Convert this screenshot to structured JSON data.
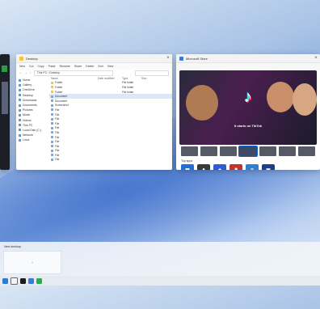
{
  "left_window": {
    "title": ""
  },
  "explorer": {
    "title": "Desktop",
    "toolbar": [
      "New",
      "Cut",
      "Copy",
      "Paste",
      "Rename",
      "Share",
      "Delete",
      "Sort",
      "View"
    ],
    "address": "This PC › Desktop",
    "sidebar": [
      "Home",
      "Gallery",
      "OneDrive",
      "Desktop",
      "Downloads",
      "Documents",
      "Pictures",
      "Music",
      "Videos",
      "This PC",
      "Local Disk (C:)",
      "Network",
      "Linux"
    ],
    "columns": [
      "Name",
      "Date modified",
      "Type",
      "Size"
    ],
    "rows": [
      {
        "name": "Folder",
        "date": "",
        "type": "File folder",
        "size": "",
        "kind": "folder"
      },
      {
        "name": "Folder",
        "date": "",
        "type": "File folder",
        "size": "",
        "kind": "folder"
      },
      {
        "name": "Folder",
        "date": "",
        "type": "File folder",
        "size": "",
        "kind": "folder"
      },
      {
        "name": "Document",
        "date": "",
        "type": "",
        "size": "",
        "kind": "doc"
      },
      {
        "name": "Document",
        "date": "",
        "type": "",
        "size": "",
        "kind": "doc"
      },
      {
        "name": "Screenshot",
        "date": "",
        "type": "",
        "size": "",
        "kind": "doc"
      },
      {
        "name": "File",
        "date": "",
        "type": "",
        "size": "",
        "kind": "doc"
      },
      {
        "name": "File",
        "date": "",
        "type": "",
        "size": "",
        "kind": "doc"
      },
      {
        "name": "File",
        "date": "",
        "type": "",
        "size": "",
        "kind": "doc"
      },
      {
        "name": "File",
        "date": "",
        "type": "",
        "size": "",
        "kind": "doc"
      },
      {
        "name": "File",
        "date": "",
        "type": "",
        "size": "",
        "kind": "doc"
      },
      {
        "name": "File",
        "date": "",
        "type": "",
        "size": "",
        "kind": "doc"
      },
      {
        "name": "File",
        "date": "",
        "type": "",
        "size": "",
        "kind": "doc"
      },
      {
        "name": "File",
        "date": "",
        "type": "",
        "size": "",
        "kind": "doc"
      },
      {
        "name": "File",
        "date": "",
        "type": "",
        "size": "",
        "kind": "doc"
      },
      {
        "name": "File",
        "date": "",
        "type": "",
        "size": "",
        "kind": "doc"
      },
      {
        "name": "File",
        "date": "",
        "type": "",
        "size": "",
        "kind": "doc"
      },
      {
        "name": "File",
        "date": "",
        "type": "",
        "size": "",
        "kind": "doc"
      }
    ],
    "status": ""
  },
  "store": {
    "title": "Microsoft Store",
    "hero_title": "It starts on TikTok",
    "hero_sub": "",
    "section_title": "Top apps",
    "apps": [
      {
        "name": "",
        "color": "#1f6fd6",
        "glyph": "▦"
      },
      {
        "name": "",
        "color": "#3a3a3a",
        "glyph": "●"
      },
      {
        "name": "",
        "color": "#2d5bd8",
        "glyph": "◆"
      },
      {
        "name": "",
        "color": "#c6332a",
        "glyph": "■"
      },
      {
        "name": "",
        "color": "#2f7fd0",
        "glyph": "✕"
      },
      {
        "name": "",
        "color": "#1b3f8a",
        "glyph": "▣"
      }
    ]
  },
  "desktops": {
    "label": "New desktop",
    "add_symbol": "+"
  },
  "colors": {
    "accent": "#0a64d0",
    "folder": "#f4c542"
  }
}
